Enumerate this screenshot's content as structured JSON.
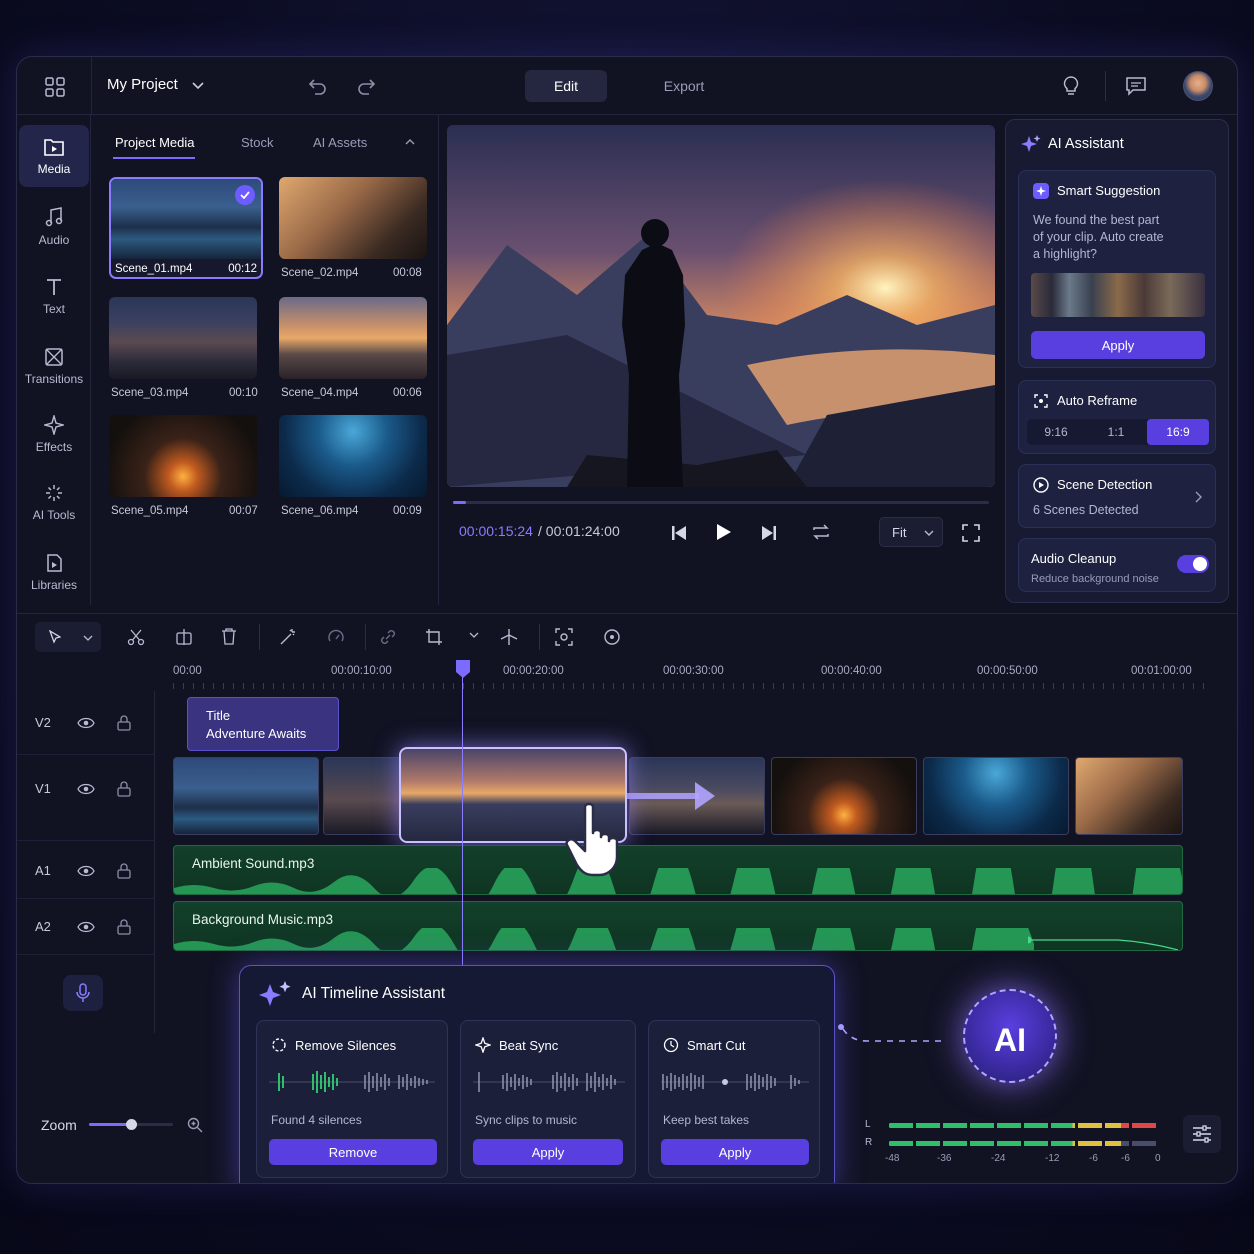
{
  "topbar": {
    "project_name": "My Project",
    "edit_label": "Edit",
    "export_label": "Export"
  },
  "sidebar": {
    "items": [
      {
        "label": "Media",
        "icon": "media-icon"
      },
      {
        "label": "Audio",
        "icon": "music-note-icon"
      },
      {
        "label": "Text",
        "icon": "text-icon"
      },
      {
        "label": "Transitions",
        "icon": "transitions-icon"
      },
      {
        "label": "Effects",
        "icon": "sparkle-icon"
      },
      {
        "label": "AI Tools",
        "icon": "ai-tools-icon"
      },
      {
        "label": "Libraries",
        "icon": "libraries-icon"
      }
    ]
  },
  "media": {
    "tabs": [
      "Project Media",
      "Stock",
      "AI Assets"
    ],
    "clips": [
      {
        "name": "Scene_01.mp4",
        "duration": "00:12",
        "selected": true
      },
      {
        "name": "Scene_02.mp4",
        "duration": "00:08"
      },
      {
        "name": "Scene_03.mp4",
        "duration": "00:10"
      },
      {
        "name": "Scene_04.mp4",
        "duration": "00:06"
      },
      {
        "name": "Scene_05.mp4",
        "duration": "00:07"
      },
      {
        "name": "Scene_06.mp4",
        "duration": "00:09"
      }
    ]
  },
  "player": {
    "current_time": "00:00:15:24",
    "total_time": "/ 00:01:24:00",
    "fit_label": "Fit",
    "progress": 0.025
  },
  "ai_assistant": {
    "title": "AI Assistant",
    "smart_suggestion": {
      "title": "Smart Suggestion",
      "text_lines": [
        "We found the best part",
        "of your clip. Auto create",
        "a highlight?"
      ],
      "apply_label": "Apply"
    },
    "auto_reframe": {
      "title": "Auto Reframe",
      "options": [
        "9:16",
        "1:1",
        "16:9"
      ],
      "selected": "16:9"
    },
    "scene_detection": {
      "title": "Scene Detection",
      "subtitle": "6 Scenes Detected"
    },
    "audio_cleanup": {
      "title": "Audio Cleanup",
      "subtitle": "Reduce background noise",
      "enabled": true
    }
  },
  "timeline": {
    "ruler_labels": [
      "00:00",
      "00:00:10:00",
      "00:00:20:00",
      "00:00:30:00",
      "00:00:40:00",
      "00:00:50:00",
      "00:01:00:00"
    ],
    "tracks": [
      "V2",
      "V1",
      "A1",
      "A2"
    ],
    "title_clip": {
      "line1": "Title",
      "line2": "Adventure Awaits"
    },
    "audio_clips": [
      "Ambient Sound.mp3",
      "Background Music.mp3"
    ]
  },
  "timeline_assistant": {
    "title": "AI Timeline Assistant",
    "cards": [
      {
        "title": "Remove Silences",
        "desc": "Found 4 silences",
        "button": "Remove"
      },
      {
        "title": "Beat Sync",
        "desc": "Sync clips to music",
        "button": "Apply"
      },
      {
        "title": "Smart Cut",
        "desc": "Keep best takes",
        "button": "Apply"
      }
    ]
  },
  "ai_badge": "AI",
  "zoom_label": "Zoom",
  "zoom_level": 0.5,
  "meter": {
    "channels": [
      "L",
      "R"
    ],
    "scale": [
      "-48",
      "-36",
      "-24",
      "-12",
      "-6",
      "-6",
      "0"
    ]
  },
  "colors": {
    "accent": "#5a3fe0",
    "accent_light": "#8b7bff",
    "audio_green": "#2fbf6a",
    "timecode": "#8b7bff"
  }
}
